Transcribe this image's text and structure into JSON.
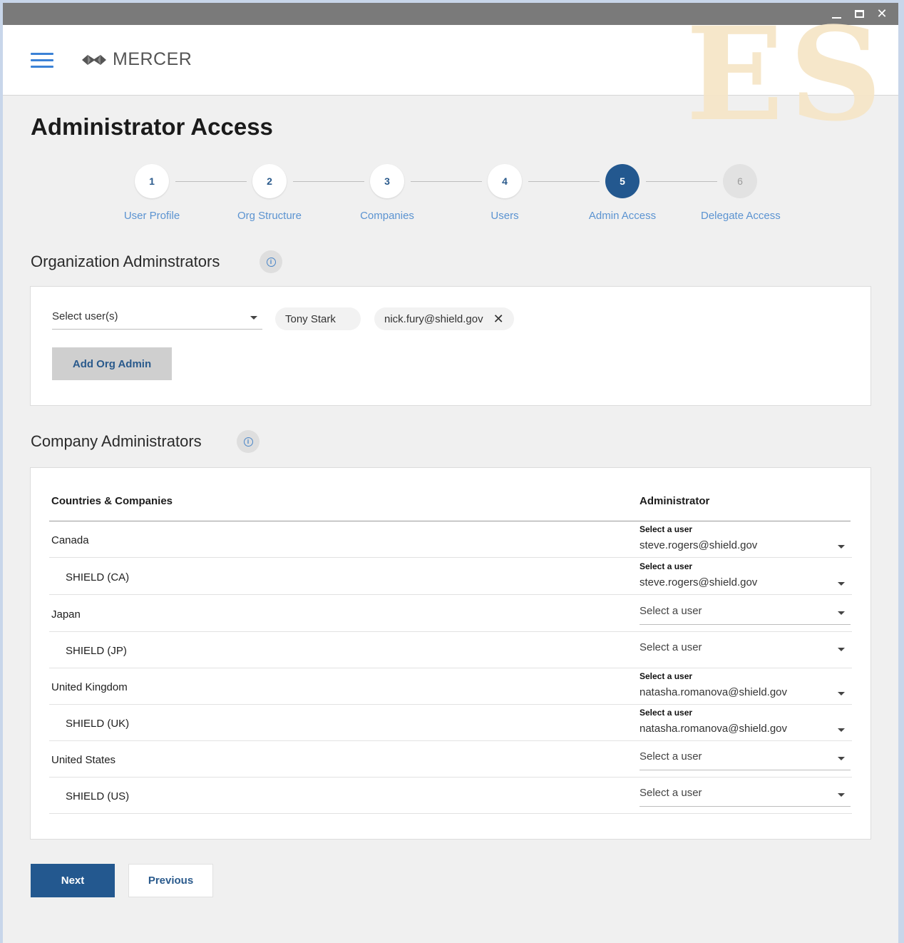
{
  "window": {
    "controls": [
      "minimize",
      "maximize",
      "close"
    ],
    "close_glyph": "✕"
  },
  "header": {
    "logo_text": "MERCER",
    "watermark": "ES"
  },
  "page_title": "Administrator Access",
  "stepper": {
    "current": 5,
    "steps": [
      {
        "number": "1",
        "label": "User Profile",
        "state": "complete"
      },
      {
        "number": "2",
        "label": "Org Structure",
        "state": "complete"
      },
      {
        "number": "3",
        "label": "Companies",
        "state": "complete"
      },
      {
        "number": "4",
        "label": "Users",
        "state": "complete"
      },
      {
        "number": "5",
        "label": "Admin Access",
        "state": "active"
      },
      {
        "number": "6",
        "label": "Delegate Access",
        "state": "disabled"
      }
    ]
  },
  "org_admins": {
    "title": "Organization Adminstrators",
    "info_glyph": "i",
    "select_placeholder": "Select user(s)",
    "chips": [
      {
        "label": "Tony Stark",
        "removable": false
      },
      {
        "label": "nick.fury@shield.gov",
        "removable": true,
        "remove_glyph": "✕"
      }
    ],
    "add_button": "Add Org Admin"
  },
  "company_admins": {
    "title": "Company Administrators",
    "info_glyph": "i",
    "col_companies": "Countries & Companies",
    "col_admin": "Administrator",
    "rows": [
      {
        "label": "Canada",
        "level": "country",
        "select_label": "Select a user",
        "value": "steve.rogers@shield.gov"
      },
      {
        "label": "SHIELD (CA)",
        "level": "company",
        "select_label": "Select a user",
        "value": "steve.rogers@shield.gov"
      },
      {
        "label": "Japan",
        "level": "country",
        "select_label": "Select a user",
        "value": ""
      },
      {
        "label": "SHIELD (JP)",
        "level": "company",
        "select_label": "Select a user",
        "value": ""
      },
      {
        "label": "United Kingdom",
        "level": "country",
        "select_label": "Select a user",
        "value": "natasha.romanova@shield.gov"
      },
      {
        "label": "SHIELD (UK)",
        "level": "company",
        "select_label": "Select a user",
        "value": "natasha.romanova@shield.gov"
      },
      {
        "label": "United States",
        "level": "country",
        "select_label": "Select a user",
        "value": ""
      },
      {
        "label": "SHIELD (US)",
        "level": "company",
        "select_label": "Select a user",
        "value": ""
      }
    ]
  },
  "footer": {
    "next": "Next",
    "previous": "Previous"
  },
  "colors": {
    "primary": "#23588f",
    "link": "#5b93d1",
    "accent_blue": "#3b82d6",
    "watermark": "#f6e6c8"
  }
}
